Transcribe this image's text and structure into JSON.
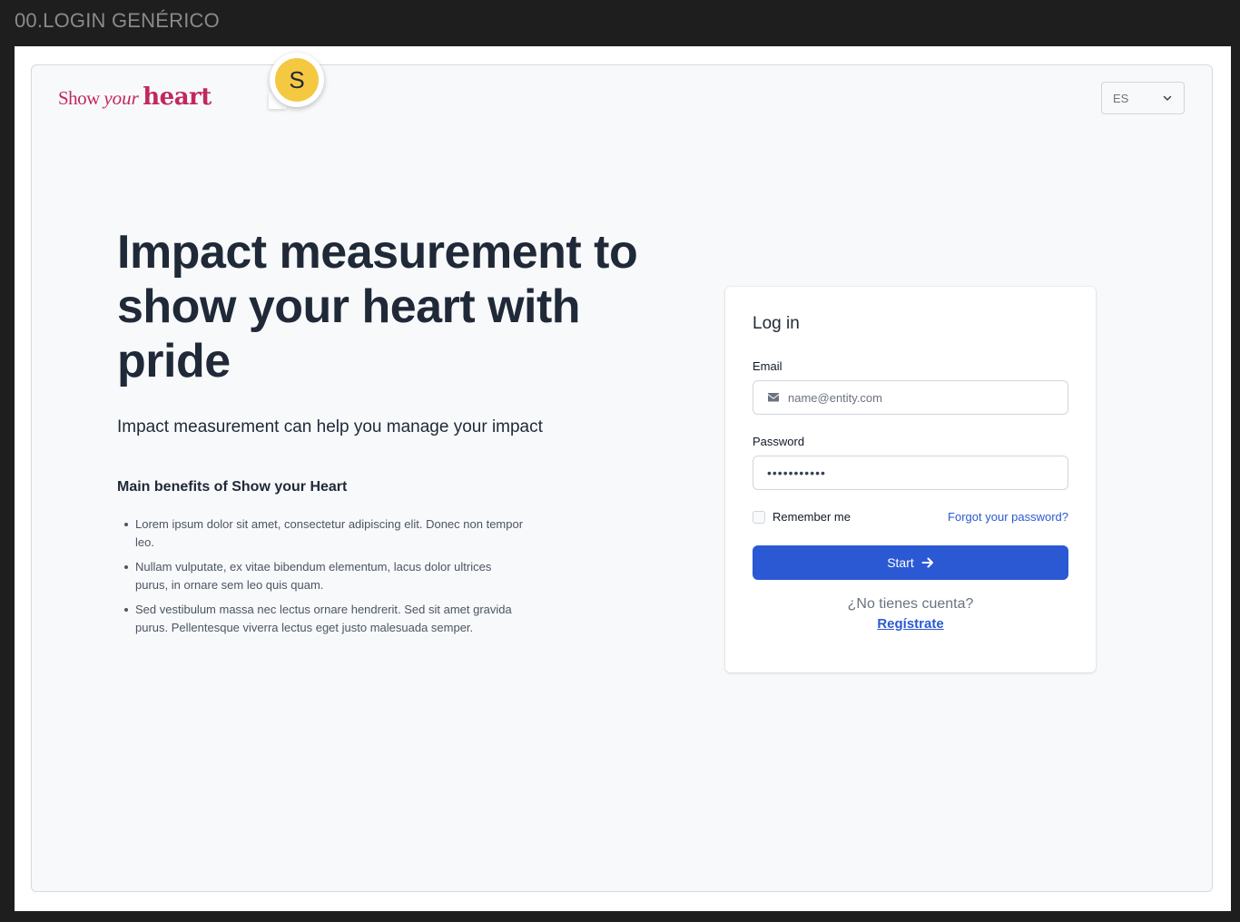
{
  "frame": {
    "title": "00.LOGIN GENÉRICO"
  },
  "header": {
    "logo": {
      "part1": "Show",
      "part2": "your",
      "part3": "heart"
    },
    "language": {
      "selected": "ES",
      "icon": "chevron-down-icon"
    },
    "avatar": {
      "initial": "S",
      "color": "#f5c842"
    }
  },
  "hero": {
    "title": "Impact measurement to show your heart with pride",
    "subtitle": "Impact measurement can help you manage your impact",
    "benefits_title": "Main benefits of Show your Heart",
    "benefits": [
      "Lorem ipsum dolor sit amet, consectetur adipiscing elit. Donec non tempor leo.",
      "Nullam vulputate, ex vitae bibendum elementum, lacus dolor ultrices purus, in ornare sem leo quis quam.",
      "Sed vestibulum massa nec lectus ornare hendrerit. Sed sit amet gravida  purus. Pellentesque viverra lectus eget justo malesuada semper."
    ]
  },
  "login": {
    "title": "Log in",
    "email_label": "Email",
    "email_placeholder": "name@entity.com",
    "email_icon": "mail-icon",
    "password_label": "Password",
    "password_value": "•••••••••••",
    "remember_label": "Remember me",
    "forgot_label": "Forgot your password?",
    "start_label": "Start",
    "start_icon": "arrow-right-icon",
    "no_account": "¿No tienes cuenta?",
    "register_label": "Regístrate"
  },
  "colors": {
    "brand": "#c1285d",
    "primary": "#2b59d4",
    "heading": "#1f2937"
  }
}
